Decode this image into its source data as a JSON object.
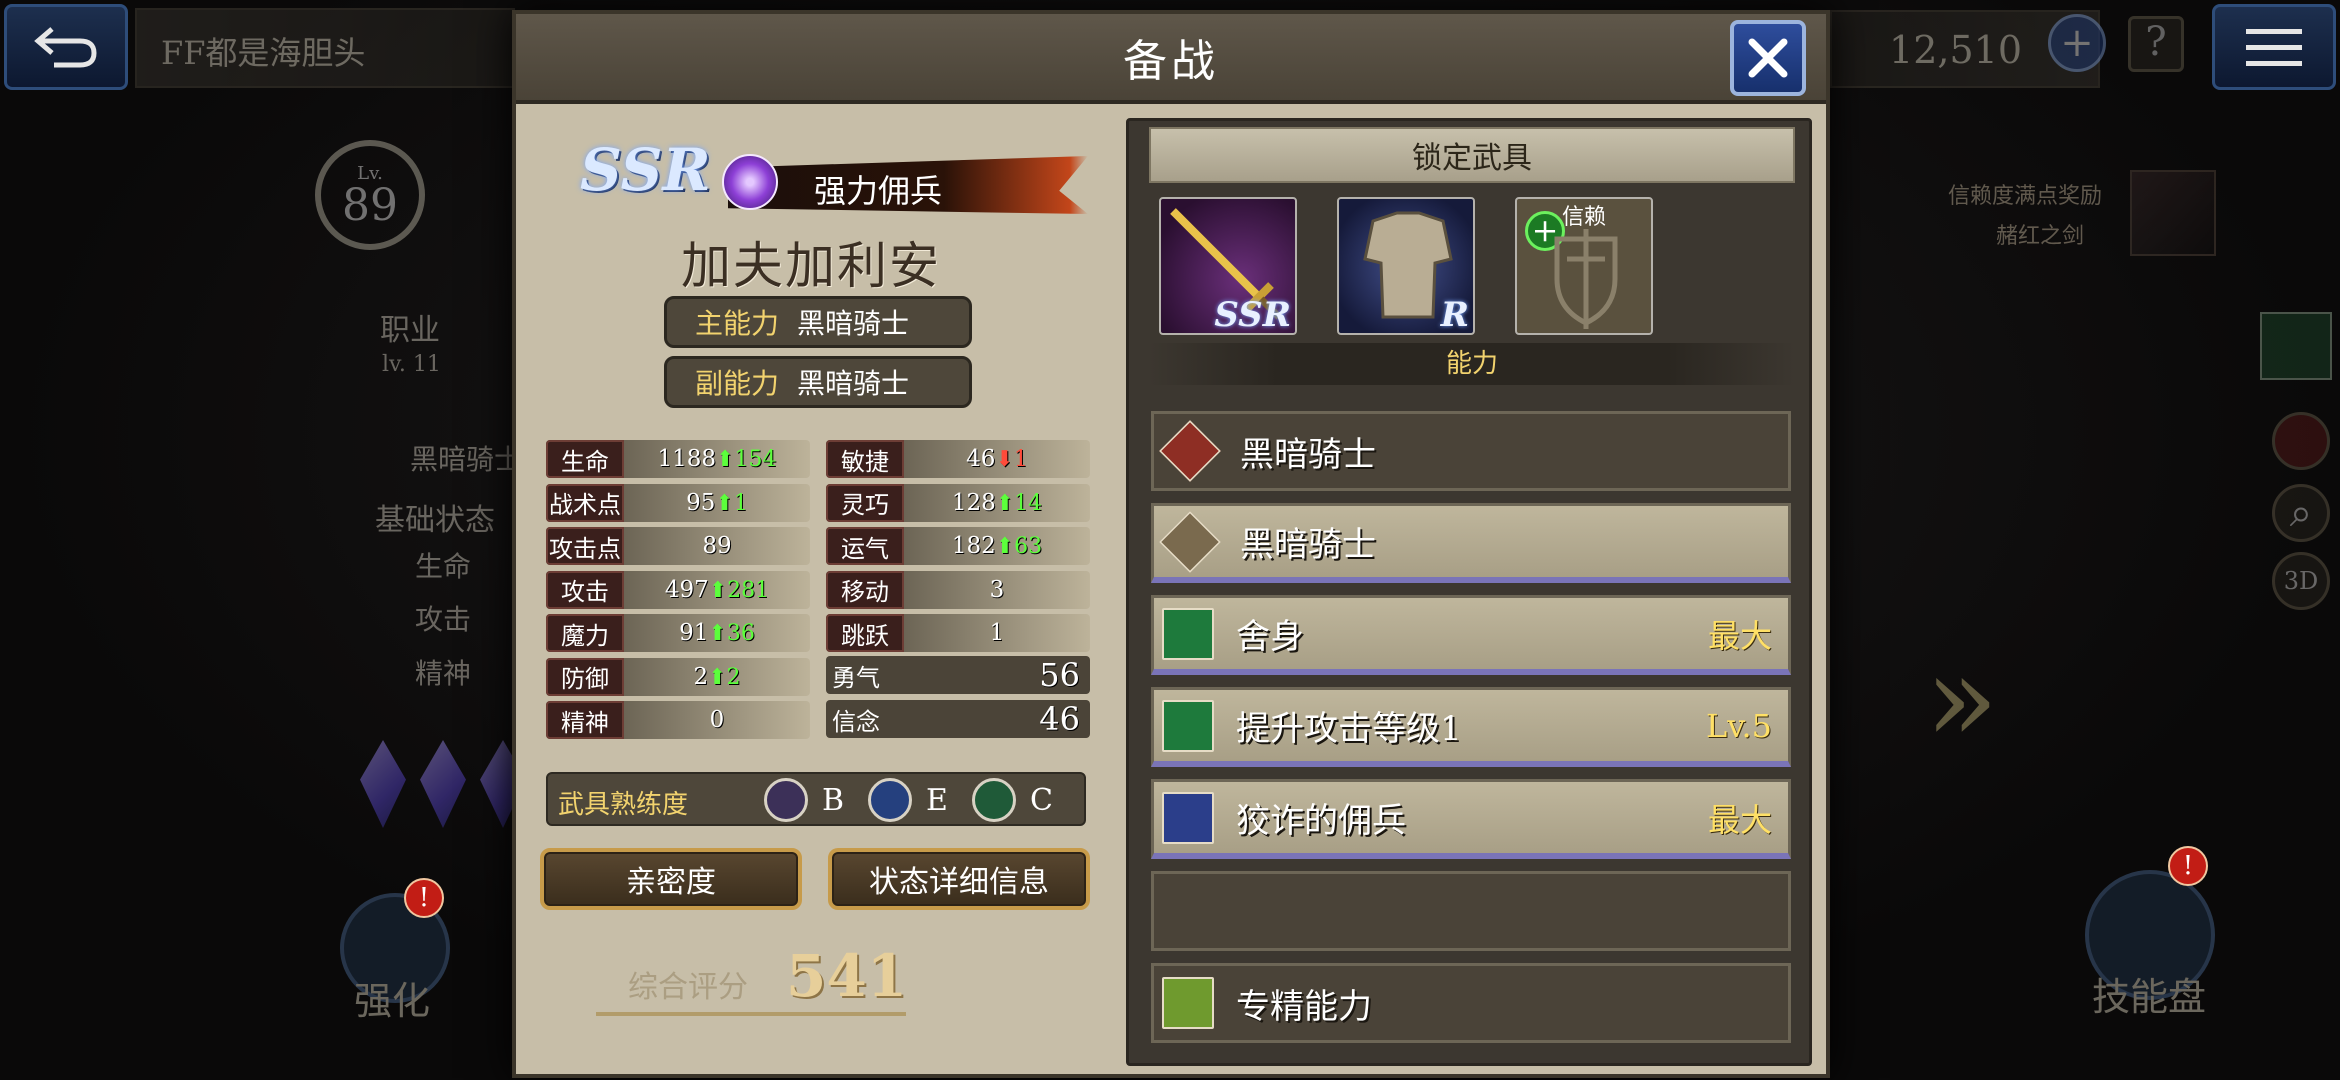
{
  "background": {
    "back_label": "↩",
    "player_name": "FF都是海胆头",
    "currency": "12,510",
    "level_label": "Lv.",
    "level_value": "89",
    "job_label": "职业",
    "job_level": "lv. 11",
    "job_name": "黑暗骑士",
    "base_status": "基础状态",
    "stat_hp": "生命",
    "stat_atk": "攻击",
    "stat_spi": "精神",
    "trust_reward": "信赖度满点奖励",
    "trust_item": "赭红之剑",
    "enhance_label": "强化",
    "skill_board_label": "技能盘",
    "side_3d": "3D",
    "badge_mark": "!"
  },
  "modal": {
    "title": "备战",
    "character": {
      "rarity": "SSR",
      "type": "强力佣兵",
      "name": "加夫加利安",
      "main_ability_key": "主能力",
      "main_ability_val": "黑暗骑士",
      "sub_ability_key": "副能力",
      "sub_ability_val": "黑暗骑士"
    },
    "stats_left": [
      {
        "label": "生命",
        "value": "1188",
        "delta": "154",
        "dir": "up"
      },
      {
        "label": "战术点",
        "value": "95",
        "delta": "1",
        "dir": "up"
      },
      {
        "label": "攻击点",
        "value": "89",
        "delta": "",
        "dir": ""
      },
      {
        "label": "攻击",
        "value": "497",
        "delta": "281",
        "dir": "up"
      },
      {
        "label": "魔力",
        "value": "91",
        "delta": "36",
        "dir": "up"
      },
      {
        "label": "防御",
        "value": "2",
        "delta": "2",
        "dir": "up"
      },
      {
        "label": "精神",
        "value": "0",
        "delta": "",
        "dir": ""
      }
    ],
    "stats_right": [
      {
        "label": "敏捷",
        "value": "46",
        "delta": "1",
        "dir": "down"
      },
      {
        "label": "灵巧",
        "value": "128",
        "delta": "14",
        "dir": "up"
      },
      {
        "label": "运气",
        "value": "182",
        "delta": "63",
        "dir": "up"
      },
      {
        "label": "移动",
        "value": "3",
        "delta": "",
        "dir": ""
      },
      {
        "label": "跳跃",
        "value": "1",
        "delta": "",
        "dir": ""
      }
    ],
    "bravery": {
      "label": "勇气",
      "value": "56"
    },
    "faith": {
      "label": "信念",
      "value": "46"
    },
    "mastery": {
      "title": "武具熟练度",
      "items": [
        {
          "icon": "sword-icon",
          "grade": "B"
        },
        {
          "icon": "armor-icon",
          "grade": "E"
        },
        {
          "icon": "accessory-icon",
          "grade": "C"
        }
      ]
    },
    "buttons": {
      "affinity": "亲密度",
      "details": "状态详细信息"
    },
    "score": {
      "label": "综合评分",
      "value": "541"
    },
    "locked_equipment": {
      "title": "锁定武具",
      "weapon_rank": "SSR",
      "armor_rank": "R",
      "trust_label": "信赖",
      "trust_plus": "+"
    },
    "abilities": {
      "title": "能力",
      "rows": [
        {
          "name": "黑暗骑士",
          "tag": "",
          "style": "dark",
          "icon": "dark-knight-icon"
        },
        {
          "name": "黑暗骑士",
          "tag": "",
          "style": "light",
          "icon": "dark-knight-icon"
        },
        {
          "name": "舍身",
          "tag": "最大",
          "style": "light",
          "icon": "ability-green-icon"
        },
        {
          "name": "提升攻击等级1",
          "tag": "Lv.5",
          "style": "light",
          "icon": "ability-green-icon"
        },
        {
          "name": "狡诈的佣兵",
          "tag": "最大",
          "style": "light",
          "icon": "ability-blue-icon"
        },
        {
          "name": "",
          "tag": "",
          "style": "dark",
          "icon": ""
        },
        {
          "name": "专精能力",
          "tag": "",
          "style": "dark",
          "icon": "mastery-ability-icon"
        }
      ]
    }
  }
}
